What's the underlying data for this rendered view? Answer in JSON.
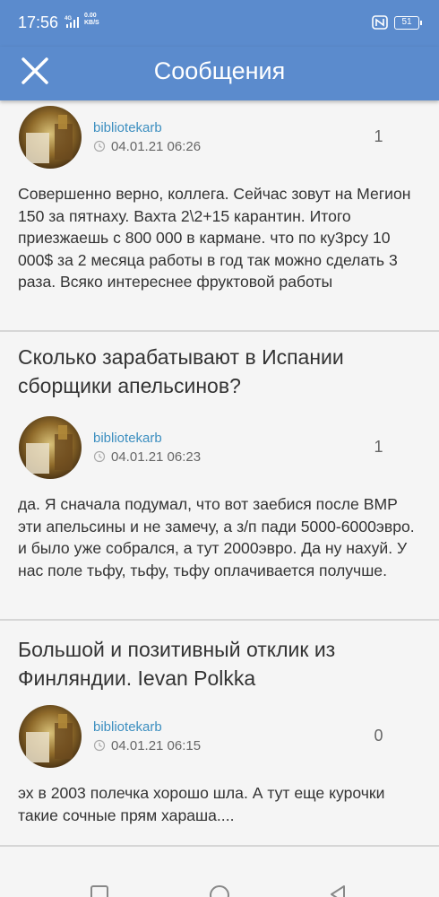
{
  "status_bar": {
    "time": "17:56",
    "signal_label": "4G",
    "speed_value": "0.00",
    "speed_unit": "KB/S",
    "battery": "51",
    "signal_icon": "signal-icon",
    "nfc_icon": "nfc-icon"
  },
  "app_bar": {
    "title": "Сообщения",
    "close_icon": "close-icon"
  },
  "posts": [
    {
      "thread_title": "",
      "author": "bibliotekarb",
      "date": "04.01.21 06:26",
      "count": "1",
      "body": "Совершенно верно, коллега. Сейчас зовут на Мегион 150 за пятнаху. Вахта 2\\2+15 карантин. Итого приезжаешь с 800 000 в кармане. что по ку3рсу 10 000$ за 2 месяца работы в год так можно сделать 3 раза. Всяко интереснее фруктовой работы"
    },
    {
      "thread_title": "Сколько зарабатывают в Испании сборщики апельсинов?",
      "author": "bibliotekarb",
      "date": "04.01.21 06:23",
      "count": "1",
      "body": "да. Я сначала подумал, что вот заебися после ВМР эти апельсины и не замечу, а з/п пади 5000-6000эвро. и было уже собрался, а тут 2000эвро. Да ну нахуй. У нас поле тьфу, тьфу, тьфу оплачивается получше."
    },
    {
      "thread_title": "Большой и позитивный отклик из Финляндии. Ievan Polkka",
      "author": "bibliotekarb",
      "date": "04.01.21 06:15",
      "count": "0",
      "body": "эх в 2003 полечка хорошо шла. А тут еще курочки такие сочные прям хараша...."
    }
  ],
  "colors": {
    "accent": "#5b8bcd",
    "author": "#3d8fc0",
    "background": "#f5f5f5",
    "divider": "#d6d6d6"
  },
  "nav_bar": {
    "back_icon": "back-triangle-icon",
    "home_icon": "home-circle-icon",
    "recents_icon": "recents-square-icon"
  }
}
